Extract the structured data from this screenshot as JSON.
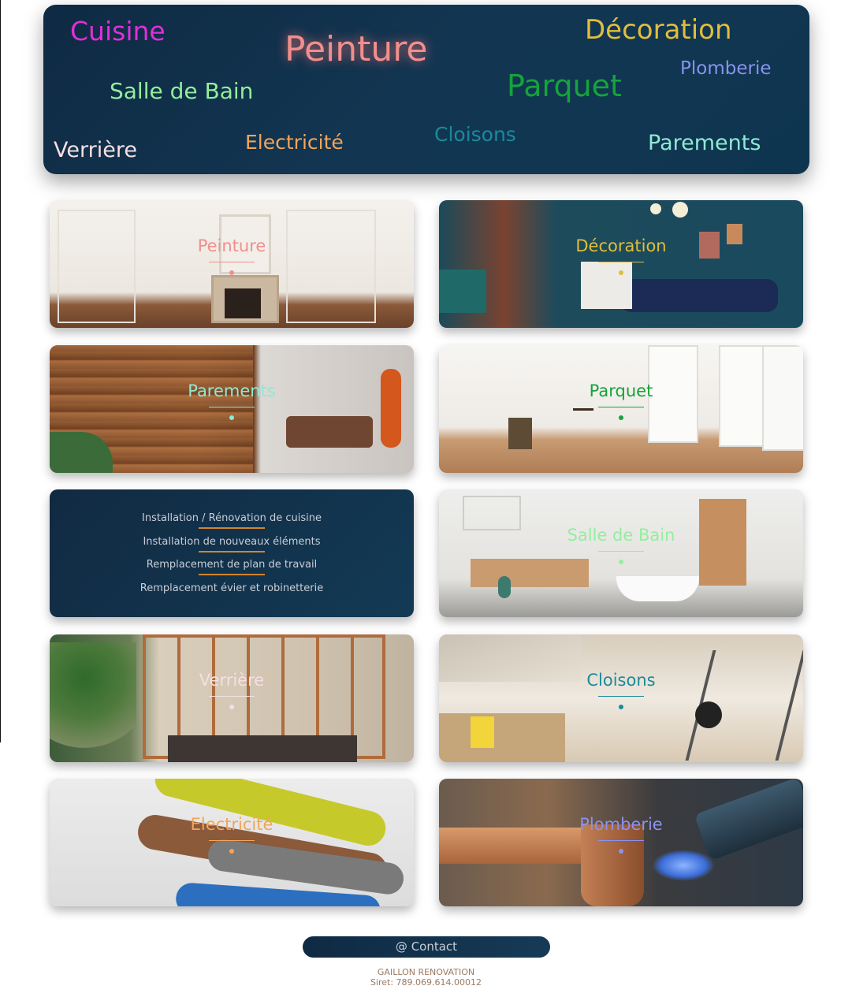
{
  "cloud": {
    "words": [
      {
        "text": "Cuisine",
        "color": "#e12fd9"
      },
      {
        "text": "Peinture",
        "color": "#f08f8c"
      },
      {
        "text": "Décoration",
        "color": "#e0be3c"
      },
      {
        "text": "Plomberie",
        "color": "#8a92ee"
      },
      {
        "text": "Salle de Bain",
        "color": "#93ef9c"
      },
      {
        "text": "Parquet",
        "color": "#16a33b"
      },
      {
        "text": "Cloisons",
        "color": "#1b8a9a"
      },
      {
        "text": "Verrière",
        "color": "#f6dfe3"
      },
      {
        "text": "Electricité",
        "color": "#f2a55c"
      },
      {
        "text": "Parements",
        "color": "#8fe9d4"
      }
    ]
  },
  "cards": {
    "peinture": {
      "title": "Peinture",
      "color": "#f08f8c"
    },
    "decoration": {
      "title": "Décoration",
      "color": "#e0be3c"
    },
    "parements": {
      "title": "Parements",
      "color": "#8fe9d4"
    },
    "parquet": {
      "title": "Parquet",
      "color": "#16a33b"
    },
    "salle": {
      "title": "Salle de Bain",
      "color": "#93ef9c"
    },
    "verriere": {
      "title": "Verrière",
      "color": "#f6dfe3"
    },
    "cloisons": {
      "title": "Cloisons",
      "color": "#1b8a9a"
    },
    "electricite": {
      "title": "Electricité",
      "color": "#f2a55c"
    },
    "plomberie": {
      "title": "Plomberie",
      "color": "#8a92ee"
    }
  },
  "cuisine_card": {
    "items": [
      "Installation / Rénovation de cuisine",
      "Installation de nouveaux éléments",
      "Remplacement de plan de travail",
      "Remplacement évier et robinetterie"
    ]
  },
  "contact": {
    "label": "@ Contact"
  },
  "footer": {
    "company": "GAILLON RENOVATION",
    "siret": "Siret: 789.069.614.00012"
  }
}
